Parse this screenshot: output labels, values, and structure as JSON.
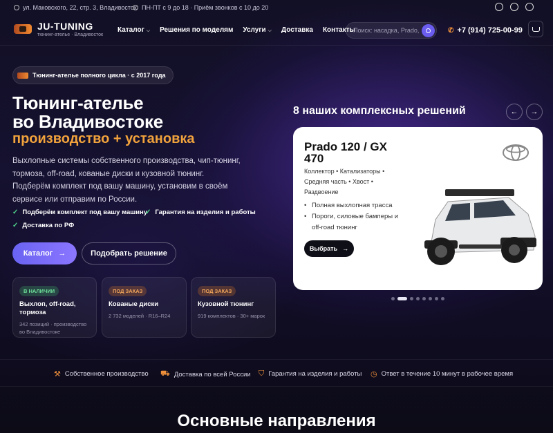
{
  "topbar": {
    "address": "ул. Маковского, 22, стр. 3, Владивосток",
    "hours": "ПН-ПТ с 9 до 18 · Приём звонков с 10 до 20"
  },
  "header": {
    "logo_name": "JU-TUNING",
    "logo_sub": "тюнинг-ателье · Владивосток",
    "nav": [
      {
        "label": "Каталог",
        "dropdown": true
      },
      {
        "label": "Решения по моделям",
        "dropdown": false
      },
      {
        "label": "Услуги",
        "dropdown": true
      },
      {
        "label": "Доставка",
        "dropdown": false
      },
      {
        "label": "Контакты",
        "dropdown": false
      }
    ],
    "search_placeholder": "Поиск: насадка, Prado, …",
    "phone": "+7 (914) 725-00-99"
  },
  "hero": {
    "badge": "Тюнинг-ателье полного цикла · с 2017 года",
    "title_line1": "Тюнинг-ателье",
    "title_line2": "во Владивостоке",
    "title_accent": "производство + установка",
    "lead": "Выхлопные системы собственного производства, чип-тюнинг, тормоза, off-road, кованые диски и кузовной тюнинг. Подберём комплект под вашу машину, установим в своём сервисе или отправим по России.",
    "checks": [
      "Подберём комплект под вашу машину",
      "Гарантия на изделия и работы",
      "Доставка по РФ"
    ],
    "btn_catalog": "Каталог",
    "btn_pick": "Подобрать решение",
    "cards": [
      {
        "tag": "В НАЛИЧИИ",
        "title": "Выхлоп, off-road, тормоза",
        "desc": "342 позиций · производство во Владивостоке"
      },
      {
        "tag": "ПОД ЗАКАЗ",
        "title": "Кованые диски",
        "desc": "2 732 моделей · R16–R24"
      },
      {
        "tag": "ПОД ЗАКАЗ",
        "title": "Кузовной тюнинг",
        "desc": "919 комплектов · 30+ марок"
      }
    ]
  },
  "slider": {
    "title": "8 наших комплексных решений",
    "prev": "←",
    "next": "→",
    "model": "Prado 120 / GX 470",
    "features": "Коллектор • Катализаторы • Средняя часть • Хвост • Раздвоение",
    "bullets": [
      "Полная выхлопная трасса",
      "Пороги, силовые бамперы и off-road тюнинг"
    ],
    "choose": "Выбрать",
    "total_slides": 8,
    "active_slide": 2
  },
  "features": [
    {
      "icon": "wrench-icon",
      "label": "Собственное производство"
    },
    {
      "icon": "truck-icon",
      "label": "Доставка по всей России"
    },
    {
      "icon": "shield-icon",
      "label": "Гарантия на изделия и работы"
    },
    {
      "icon": "clock-icon",
      "label": "Ответ в течение 10 минут в рабочее время"
    }
  ],
  "section_title": "Основные направления"
}
